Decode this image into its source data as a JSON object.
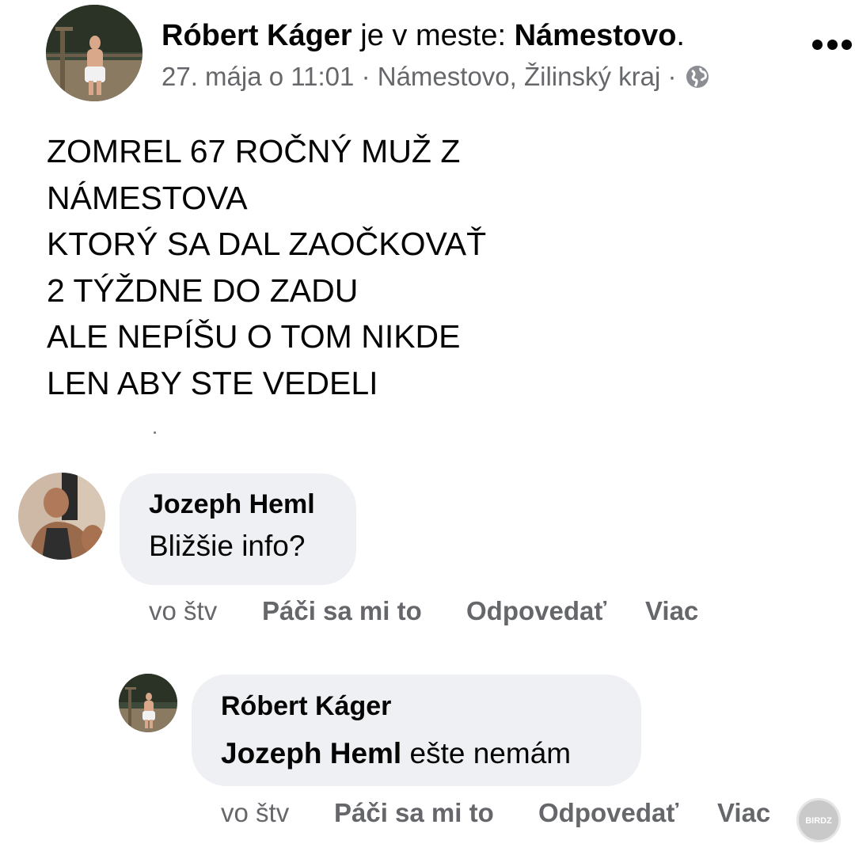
{
  "post": {
    "author": "Róbert Káger",
    "connector": "je v meste:",
    "place": "Námestovo",
    "place_suffix": ".",
    "timestamp": "27. mája o 11:01",
    "separator": "·",
    "location": "Námestovo, Žilinský kraj",
    "privacy_icon": "globe-icon",
    "more_icon": "more-options-icon",
    "body_lines": [
      "ZOMREL 67 ROČNÝ MUŽ Z",
      "NÁMESTOVA",
      "KTORÝ SA DAL ZAOČKOVAŤ",
      "2 TÝŽDNE DO ZADU",
      "ALE NEPÍŠU O TOM NIKDE",
      "LEN ABY STE VEDELI"
    ]
  },
  "comments": [
    {
      "author": "Jozeph Heml",
      "text": "Bližšie info?",
      "time": "vo štv",
      "like_label": "Páči sa mi to",
      "reply_label": "Odpovedať",
      "more_label": "Viac"
    },
    {
      "author": "Róbert Káger",
      "mention": "Jozeph Heml",
      "text": " ešte nemám",
      "time": "vo štv",
      "like_label": "Páči sa mi to",
      "reply_label": "Odpovedať",
      "more_label": "Viac"
    }
  ],
  "watermark": {
    "text": "BIRDZ"
  },
  "colors": {
    "text_primary": "#050505",
    "text_secondary": "#65676b",
    "bubble_background": "#eff0f3",
    "background": "#ffffff"
  }
}
